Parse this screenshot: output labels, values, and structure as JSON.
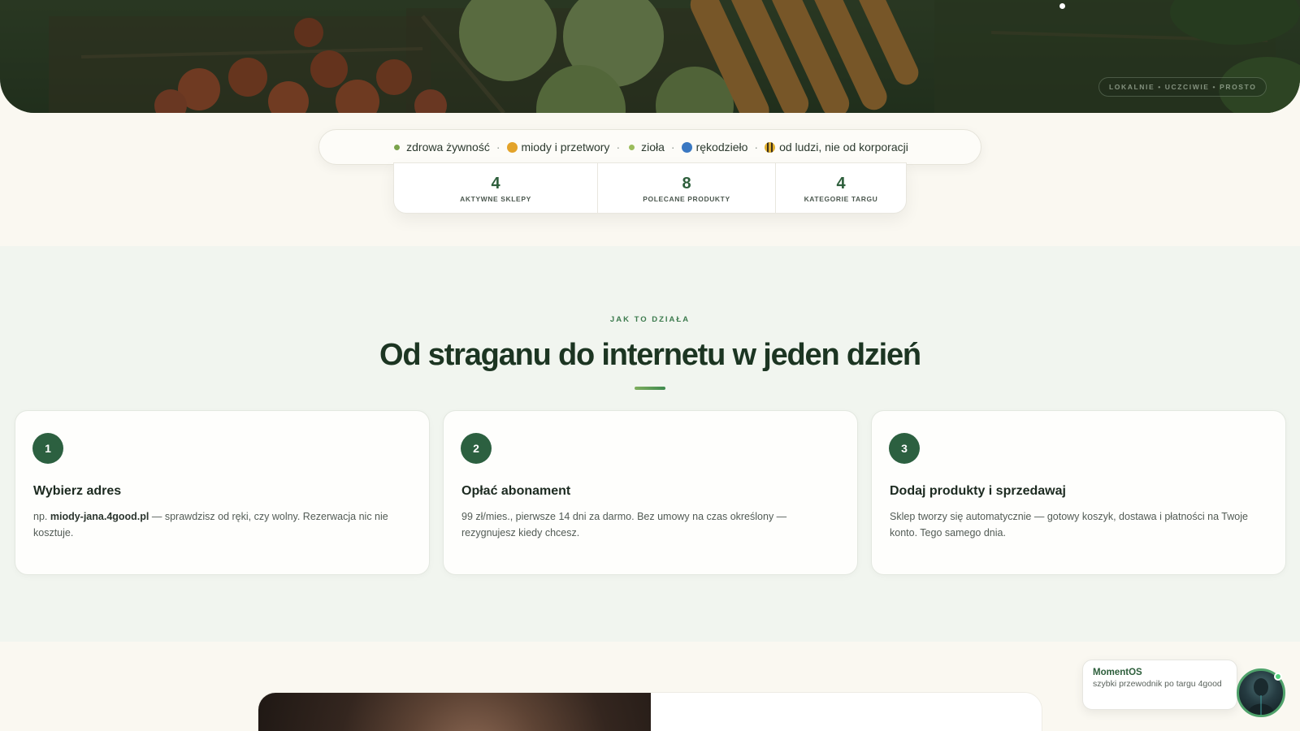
{
  "hero": {
    "badge": "LOKALNIE • UCZCIWIE • PROSTO",
    "image": "vegetable-crates-photo"
  },
  "tagline": {
    "items": [
      {
        "icon": "sprout-icon",
        "label": "zdrowa żywność"
      },
      {
        "icon": "honey-icon",
        "label": "miody i przetwory"
      },
      {
        "icon": "herb-icon",
        "label": "zioła"
      },
      {
        "icon": "yarn-icon",
        "label": "rękodzieło"
      },
      {
        "icon": "bee-icon",
        "label": "od ludzi, nie od korporacji"
      }
    ],
    "separator": "·"
  },
  "stats": [
    {
      "value": "4",
      "label": "AKTYWNE SKLEPY"
    },
    {
      "value": "8",
      "label": "POLECANE PRODUKTY"
    },
    {
      "value": "4",
      "label": "KATEGORIE TARGU"
    }
  ],
  "how": {
    "eyebrow": "JAK TO DZIAŁA",
    "title": "Od straganu do internetu w jeden dzień",
    "steps": [
      {
        "number": "1",
        "title": "Wybierz adres",
        "desc_prefix": "np. ",
        "desc_bold": "miody-jana.4good.pl",
        "desc_suffix": " — sprawdzisz od ręki, czy wolny. Rezerwacja nic nie kosztuje."
      },
      {
        "number": "2",
        "title": "Opłać abonament",
        "desc": "99 zł/mies., pierwsze 14 dni za darmo. Bez umowy na czas określony — rezygnujesz kiedy chcesz."
      },
      {
        "number": "3",
        "title": "Dodaj produkty i sprzedawaj",
        "desc": "Sklep tworzy się automatycznie — gotowy koszyk, dostawa i płatności na Twoje konto. Tego samego dnia."
      }
    ]
  },
  "chat": {
    "name": "MomentOS",
    "subtitle": "szybki przewodnik po targu 4good"
  },
  "colors": {
    "brand_green": "#2c6040",
    "accent": "#3c7a4d",
    "background": "#faf8f1",
    "section_bg": "#f1f5ef"
  }
}
